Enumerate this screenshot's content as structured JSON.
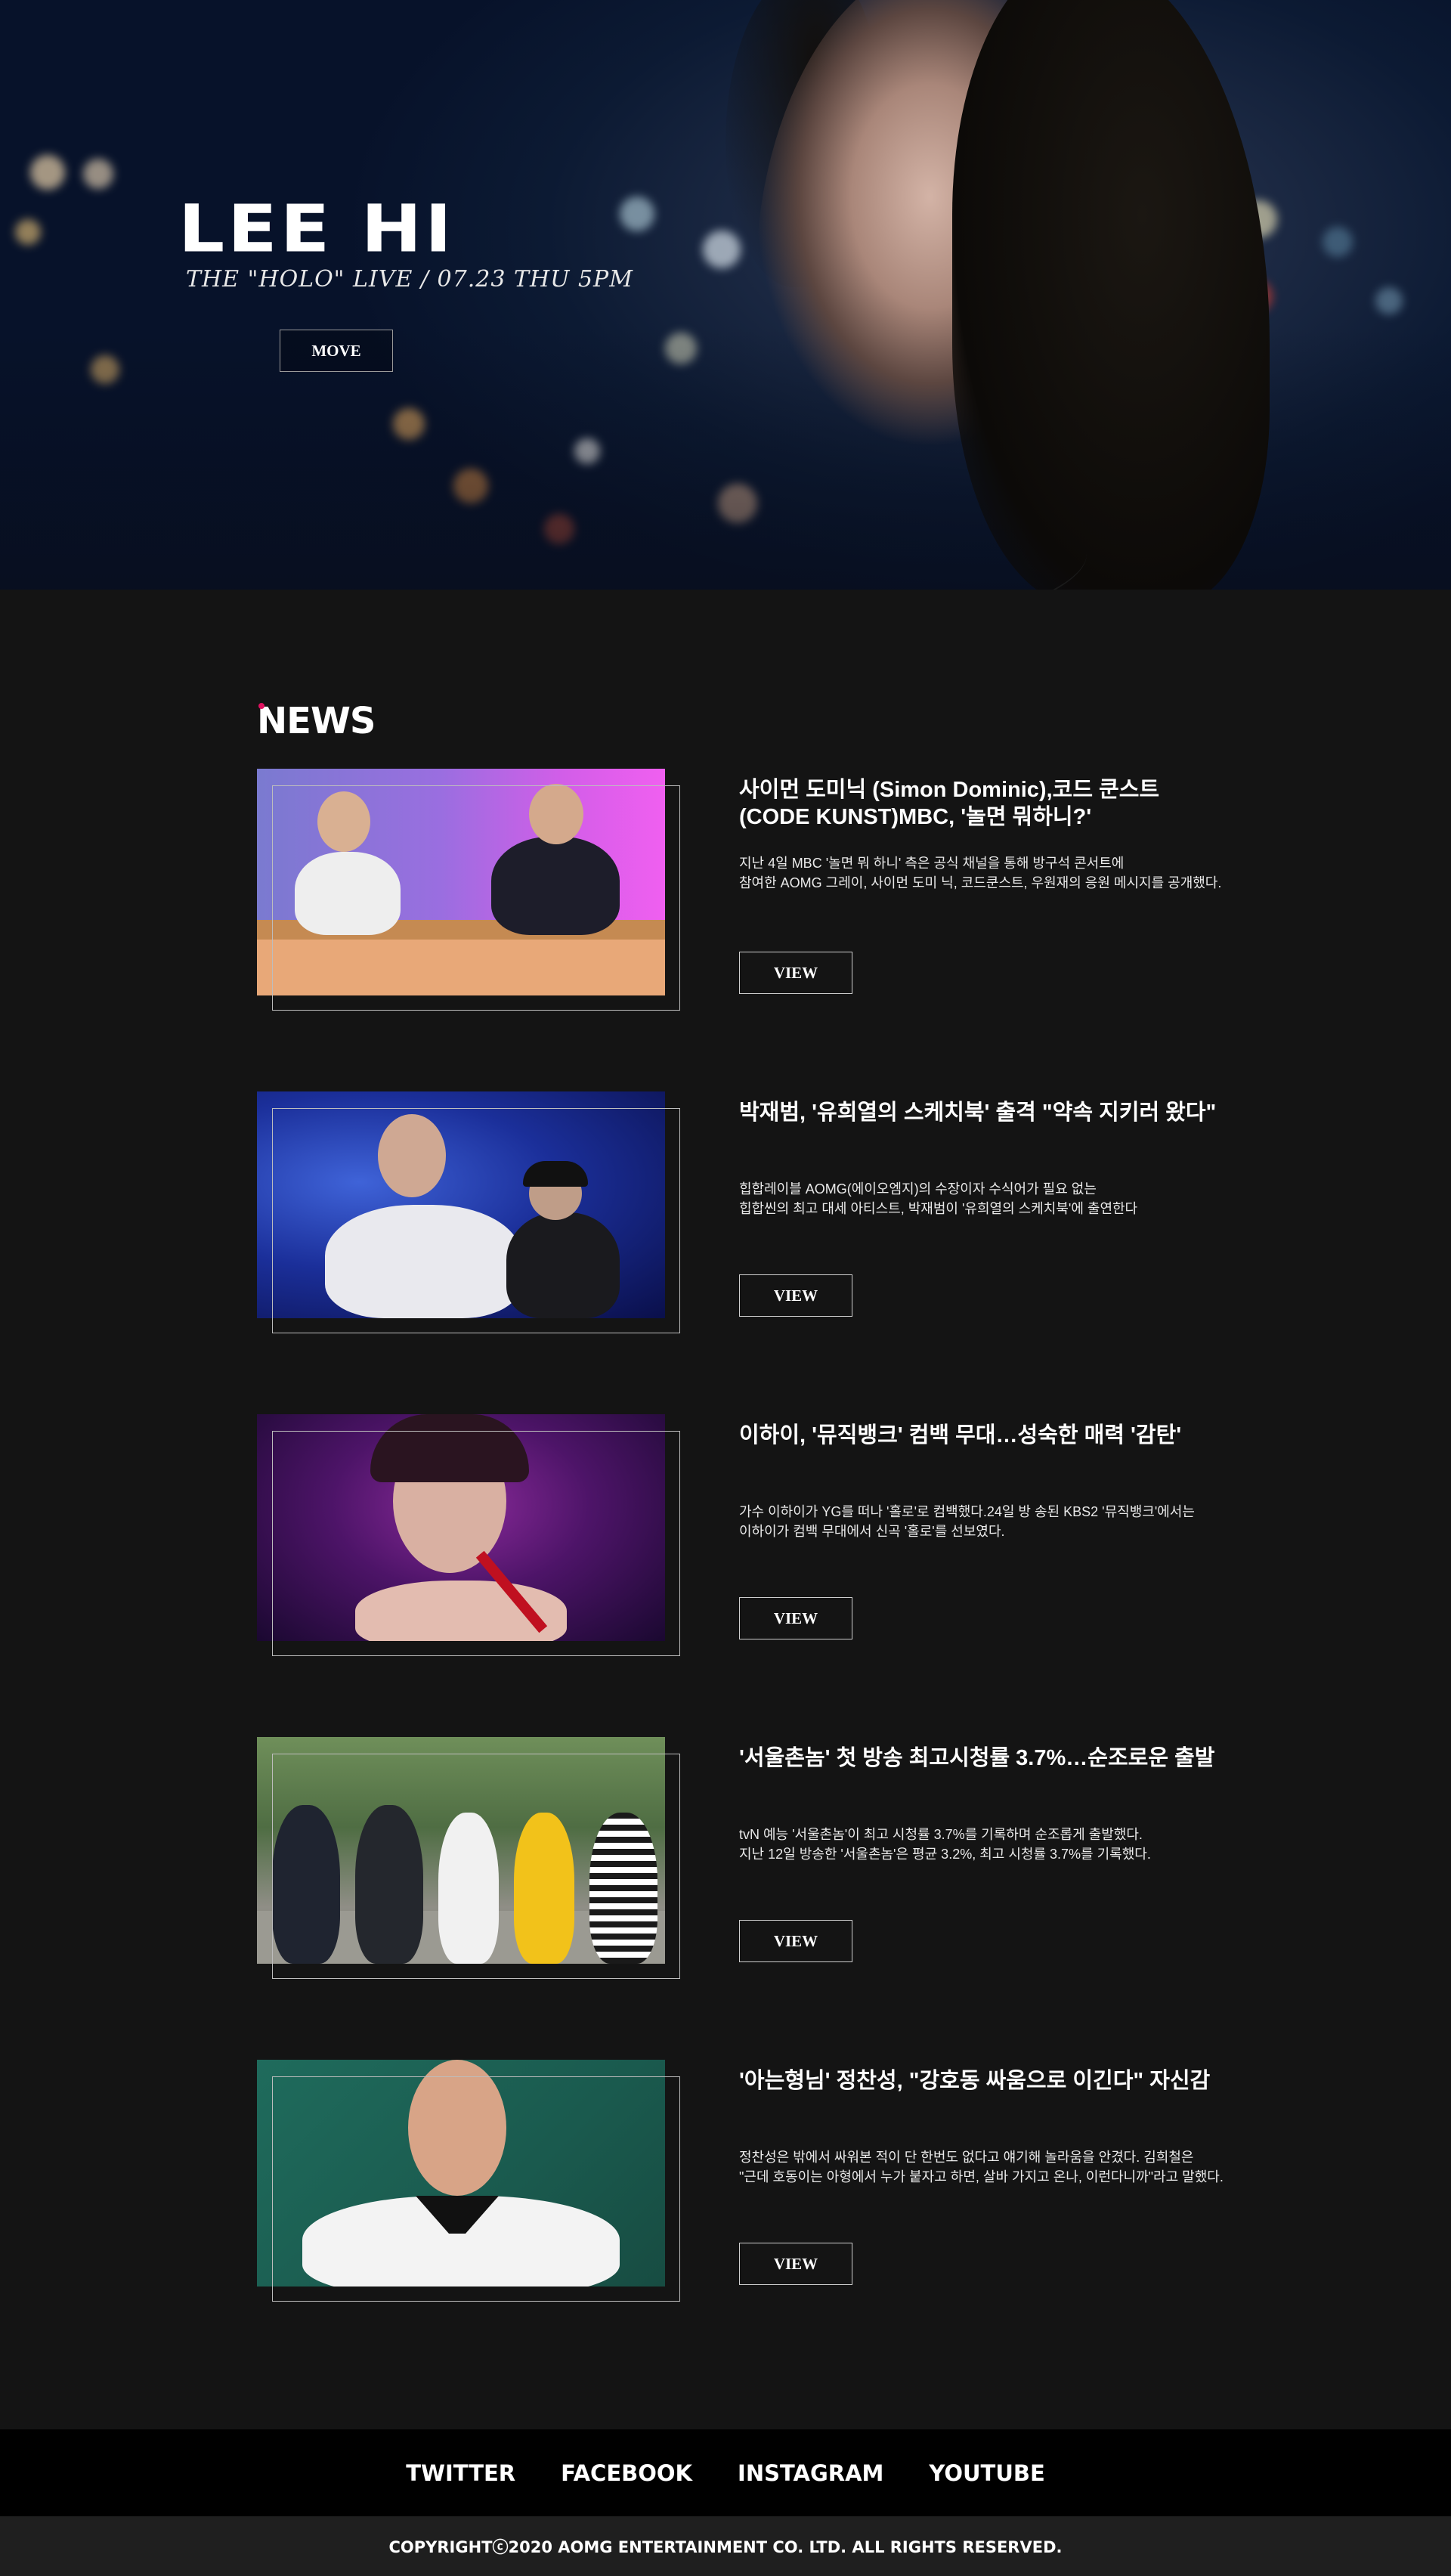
{
  "hero": {
    "title": "LEE HI",
    "subtitle": "THE \"HOLO\" LIVE / 07.23 THU 5PM",
    "button_label": "MOVE"
  },
  "news": {
    "heading": "NEWS",
    "items": [
      {
        "title": "사이먼 도미닉 (Simon Dominic),코드 쿤스트 (CODE KUNST)MBC, '놀면 뭐하니?'",
        "desc_line1": "지난 4일 MBC '놀면 뭐 하니' 측은 공식 채널을 통해 방구석 콘서트에",
        "desc_line2": "참여한 AOMG 그레이, 사이먼 도미 닉, 코드쿤스트, 우원재의 응원 메시지를 공개했다.",
        "button_label": "VIEW"
      },
      {
        "title": "박재범, '유희열의 스케치북' 출격 \"약속 지키러 왔다\"",
        "desc_line1": "힙합레이블 AOMG(에이오엠지)의 수장이자 수식어가 필요 없는",
        "desc_line2": "힙합씬의 최고 대세 아티스트, 박재범이 '유희열의 스케치북'에 출연한다",
        "button_label": "VIEW"
      },
      {
        "title": "이하이, '뮤직뱅크' 컴백 무대…성숙한 매력 '감탄'",
        "desc_line1": "가수 이하이가 YG를 떠나 '홀로'로 컴백했다.24일 방 송된 KBS2 '뮤직뱅크'에서는",
        "desc_line2": "이하이가 컴백 무대에서 신곡 '홀로'를 선보였다.",
        "button_label": "VIEW"
      },
      {
        "title": "'서울촌놈' 첫 방송 최고시청률 3.7%…순조로운 출발",
        "desc_line1": "tvN 예능 '서울촌놈'이 최고 시청률 3.7%를 기록하며 순조롭게 출발했다.",
        "desc_line2": "지난 12일 방송한 '서울촌놈'은 평균 3.2%, 최고 시청률 3.7%를 기록했다.",
        "button_label": "VIEW"
      },
      {
        "title": "'아는형님' 정찬성, \"강호동 싸움으로 이긴다\" 자신감",
        "desc_line1": " 정찬성은 밖에서 싸워본 적이 단 한번도 없다고 얘기해 놀라움을 안겼다. 김희철은",
        "desc_line2": "\"근데 호동이는 아형에서 누가 붙자고 하면, 살바 가지고 온나, 이런다니까\"라고 말했다.",
        "button_label": "VIEW"
      }
    ]
  },
  "footer": {
    "links": [
      "TWITTER",
      "FACEBOOK",
      "INSTAGRAM",
      "YOUTUBE"
    ],
    "copyright": "COPYRIGHTⓒ2020 AOMG ENTERTAINMENT CO. LTD. ALL RIGHTS RESERVED."
  }
}
